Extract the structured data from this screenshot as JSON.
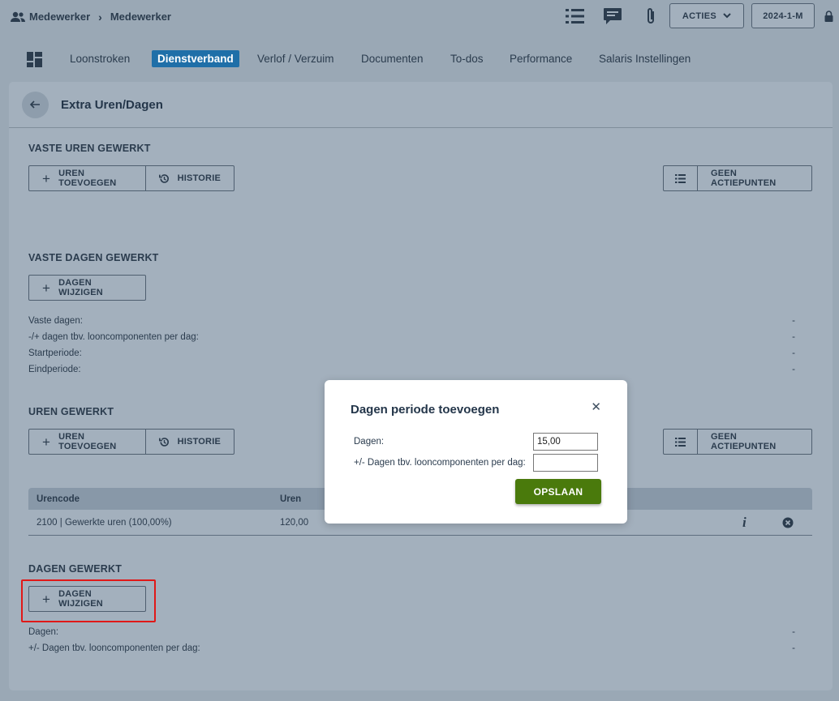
{
  "breadcrumb": {
    "root": "Medewerker",
    "current": "Medewerker"
  },
  "topbar": {
    "acties_label": "ACTIES",
    "period_label": "2024-1-M",
    "icons": [
      "list-icon",
      "chat-icon",
      "paperclip-icon",
      "lock-icon"
    ]
  },
  "nav": {
    "tabs": [
      {
        "label": "Loonstroken"
      },
      {
        "label": "Dienstverband",
        "active": true
      },
      {
        "label": "Verlof / Verzuim"
      },
      {
        "label": "Documenten"
      },
      {
        "label": "To-dos"
      },
      {
        "label": "Performance"
      },
      {
        "label": "Salaris Instellingen"
      }
    ]
  },
  "panel": {
    "title": "Extra Uren/Dagen"
  },
  "vaste_uren": {
    "title": "VASTE UREN GEWERKT",
    "add_label": "UREN TOEVOEGEN",
    "history_label": "HISTORIE",
    "actions_label": "GEEN ACTIEPUNTEN"
  },
  "vaste_dagen": {
    "title": "VASTE DAGEN GEWERKT",
    "change_label": "DAGEN WIJZIGEN",
    "rows": [
      {
        "label": "Vaste dagen:",
        "value": "-"
      },
      {
        "label": "-/+ dagen tbv. looncomponenten per dag:",
        "value": "-"
      },
      {
        "label": "Startperiode:",
        "value": "-"
      },
      {
        "label": "Eindperiode:",
        "value": "-"
      }
    ]
  },
  "uren": {
    "title": "UREN GEWERKT",
    "add_label": "UREN TOEVOEGEN",
    "history_label": "HISTORIE",
    "actions_label": "GEEN ACTIEPUNTEN",
    "columns": [
      "Urencode",
      "Uren"
    ],
    "rows": [
      {
        "code": "2100 | Gewerkte uren (100,00%)",
        "hours": "120,00"
      }
    ]
  },
  "dagen": {
    "title": "DAGEN GEWERKT",
    "change_label": "DAGEN WIJZIGEN",
    "rows": [
      {
        "label": "Dagen:",
        "value": "-"
      },
      {
        "label": "+/- Dagen tbv. looncomponenten per dag:",
        "value": "-"
      }
    ]
  },
  "modal": {
    "title": "Dagen periode toevoegen",
    "days_label": "Dagen:",
    "days_value": "15,00",
    "extra_label": "+/- Dagen tbv. looncomponenten per dag:",
    "extra_value": "",
    "save_label": "OPSLAAN"
  },
  "colors": {
    "accent": "#1f6fa8",
    "save": "#4a7a0c",
    "highlight": "#e01818"
  }
}
